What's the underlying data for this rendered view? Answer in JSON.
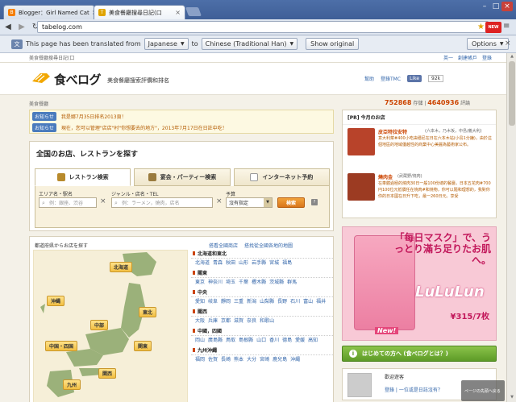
{
  "browser": {
    "tabs": [
      {
        "title": "Blogger：Girl Named Cat",
        "fav": "B",
        "fav_color": "#f57d00"
      },
      {
        "title": "美食餐廳搜尋日記(口",
        "fav": "T",
        "fav_color": "#e0a400"
      }
    ],
    "url": "tabelog.com",
    "new_badge": "NEW"
  },
  "translate": {
    "prefix": "This page has been translated from",
    "from_lang": "Japanese",
    "to_word": "to",
    "to_lang": "Chinese (Traditional Han)",
    "show_original": "Show original",
    "options": "Options"
  },
  "site": {
    "util_left": "美食餐廳搜尋日記(口",
    "util_right": [
      "英一",
      "創建帳戶",
      "登錄"
    ],
    "logo": "食べログ",
    "tagline": "美食餐廳搜索評價和排名",
    "header_links": [
      "幫助",
      "登錄TMC"
    ],
    "like": "Like",
    "like_count": "92k",
    "breadcrumb": "美食餐廳",
    "stat_shops": "752868",
    "stat_shops_unit": "存儲",
    "stat_reviews": "4640936",
    "stat_reviews_unit": "評論"
  },
  "notices": [
    {
      "badge": "お知らせ",
      "text": "我是娜7月35日排名2013頁！"
    },
    {
      "badge": "お知らせ",
      "text": "現在，您可以管理\"店店\"村\"你想要去的地方\"，2013年7月17日在日註中吃！"
    }
  ],
  "search": {
    "title": "全国のお店、レストランを探す",
    "tabs": [
      "レストラン検索",
      "宴会・パーティー検索",
      "インターネット予約"
    ],
    "area_label": "エリア名・駅名",
    "area_placeholder": "例：銀座、渋谷",
    "genre_label": "ジャンル・店名・TEL",
    "genre_placeholder": "例：ラーメン，燒肉，店名",
    "budget_label": "予算",
    "budget_value": "沒有指定",
    "search_button": "検索",
    "help": "?"
  },
  "map": {
    "caption": "都道府県からお店を探す",
    "links": [
      "搭看全國商店",
      "搭找從全國各地的地圖"
    ],
    "regions": [
      {
        "label": "北海道"
      },
      {
        "label": "沖縄"
      },
      {
        "label": "東北"
      },
      {
        "label": "中部"
      },
      {
        "label": "関東"
      },
      {
        "label": "中国・四国"
      },
      {
        "label": "関西"
      },
      {
        "label": "九州"
      }
    ],
    "groups": [
      {
        "name": "北海道和東北",
        "links": [
          "北海道",
          "青森",
          "秋田",
          "山形",
          "岩手縣",
          "宮城",
          "福島"
        ]
      },
      {
        "name": "關東",
        "links": [
          "東京",
          "神奈川",
          "埼玉",
          "千葉",
          "櫪木縣",
          "茨城縣",
          "群馬"
        ]
      },
      {
        "name": "中央",
        "links": [
          "愛知",
          "岐阜",
          "靜岡",
          "三重",
          "新潟",
          "山梨縣",
          "長野",
          "石川",
          "富山",
          "福井"
        ]
      },
      {
        "name": "關西",
        "links": [
          "大阪",
          "兵庫",
          "京都",
          "滋賀",
          "奈良",
          "和歌山"
        ]
      },
      {
        "name": "中國，四國",
        "links": [
          "岡山",
          "廣島縣",
          "鳥取",
          "島根縣",
          "山口",
          "香川",
          "德島",
          "愛媛",
          "高知"
        ]
      },
      {
        "name": "九州沖繩",
        "links": [
          "福岡",
          "佐賀",
          "長崎",
          "熊本",
          "大分",
          "宮崎",
          "鹿兒島",
          "沖繩"
        ]
      }
    ]
  },
  "sidebar": {
    "pr_title": "[PR] 今月のお店",
    "pr_items": [
      {
        "name": "皮亞特拉安特",
        "meta": "(六本木，乃木坂，中島/義大利)",
        "desc": "意大利菜#400小吃由穩尼在日在六本木站(小島1分鐘)，由於這個地區的地域優越性的商業中心美麗為藝術家公布。"
      },
      {
        "name": "燒肉金",
        "meta": "(武蔵野/燒肉)",
        "desc": "在車體過極的燒肉30日一般100份總的餐廳，日本五花肉#700円100位元抵價任在燒肉#和燒物，你可以隨和理想的，我對你你的日本國在日升下吃，最一260日元。享受"
      }
    ],
    "ad": {
      "top_text": "「每日マスク」で、うっとり滿ち足りたお肌へ。",
      "brand": "LuLuLun",
      "price": "¥315/7枚",
      "new": "New!"
    },
    "green_button": "はじめての方へ (食べログとは？)",
    "welcome": "歡迎遊客",
    "welcome_link": "登錄 | 一位或是日誌沒有？"
  },
  "to_top": "ページの先頭へ戻る"
}
